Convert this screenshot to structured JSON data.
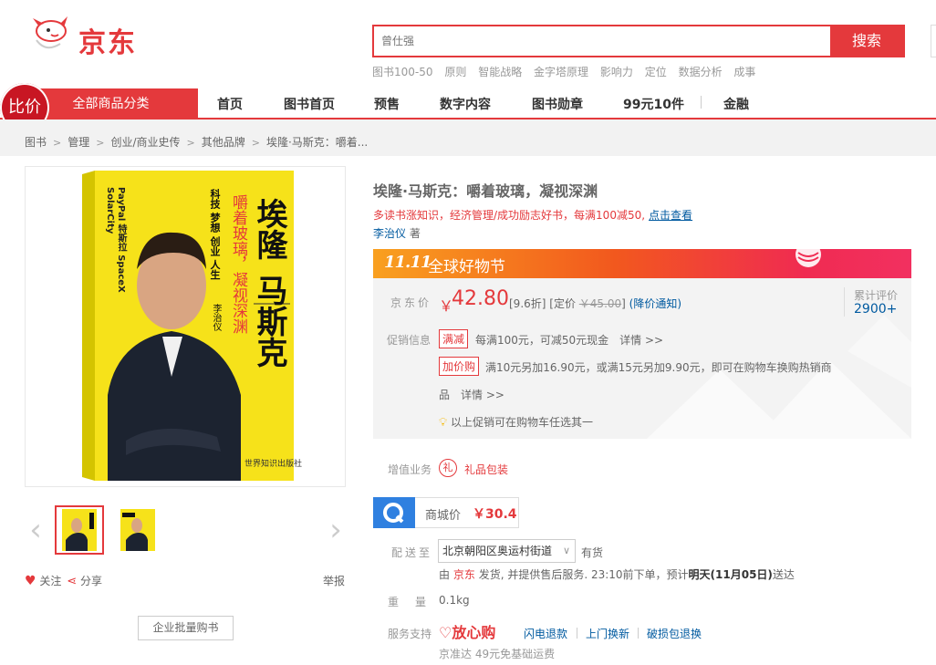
{
  "brand": {
    "logo_text": "京东",
    "accent": "#e4393c"
  },
  "search": {
    "placeholder": "曾仕强",
    "button": "搜索"
  },
  "hotwords": [
    "图书100-50",
    "原则",
    "智能战略",
    "金字塔原理",
    "影响力",
    "定位",
    "数据分析",
    "成事"
  ],
  "nav": {
    "category": "全部商品分类",
    "bijia": "比价",
    "items": [
      "首页",
      "图书首页",
      "预售",
      "数字内容",
      "图书勋章",
      "99元10件",
      "金融"
    ]
  },
  "breadcrumb": [
    "图书",
    "管理",
    "创业/商业史传",
    "其他品牌",
    "埃隆·马斯克：嚼着..."
  ],
  "gallery": {
    "cover": {
      "title_line1": "埃隆",
      "title_line2": "马斯克",
      "subtitle": "嚼着玻璃，凝视深渊",
      "side_tags": "PayPal 特斯拉 SpaceX SolarCity",
      "keywords": "科技 梦想 创业 人生",
      "author": "李治仪",
      "publisher": "世界知识出版社"
    },
    "follow": "关注",
    "share": "分享",
    "report": "举报",
    "bulk_buy": "企业批量购书"
  },
  "product": {
    "title": "埃隆·马斯克：嚼着玻璃，凝视深渊",
    "promo_line": "多读书涨知识，经济管理/成功励志好书，每满100减50,",
    "promo_link": "点击查看",
    "author": "李治仪",
    "author_suffix": "著",
    "banner_logo": "11.11",
    "banner_text": "全球好物节",
    "price_label": "京东价",
    "currency": "￥",
    "price": "42.80",
    "discount": "[9.6折]",
    "list_price_label": "[定价",
    "list_price": "￥45.00",
    "list_price_close": "]",
    "price_notice": "(降价通知)",
    "rating_label": "累计评价",
    "rating_count": "2900+",
    "promo_label": "促销信息",
    "promo_tag1": "满减",
    "promo_text1": "每满100元，可减50元现金　详情 >>",
    "promo_tag2": "加价购",
    "promo_text2": "满10元另加16.90元，或满15元另加9.90元，即可在购物车换购热销商",
    "promo_text2b": "品　详情 >>",
    "promo_tip": "以上促销可在购物车任选其一",
    "vas_label": "增值业务",
    "vas_gift": "礼品包装",
    "mall_label": "商城价",
    "mall_price": "￥30.4",
    "ship_label": "配送至",
    "ship_location": "北京朝阳区奥运村街道",
    "stock": "有货",
    "ship_prefix": "由",
    "ship_seller": "京东",
    "ship_text": "发货, 并提供售后服务. 23:10前下单，预计",
    "ship_date": "明天(11月05日)",
    "ship_suffix": "送达",
    "weight_label": "重量",
    "weight": "0.1kg",
    "service_label": "服务支持",
    "service_badge": "放心购",
    "services": [
      "闪电退款",
      "上门换新",
      "破损包退换"
    ],
    "jzd": "京准达  49元免基础运费"
  }
}
